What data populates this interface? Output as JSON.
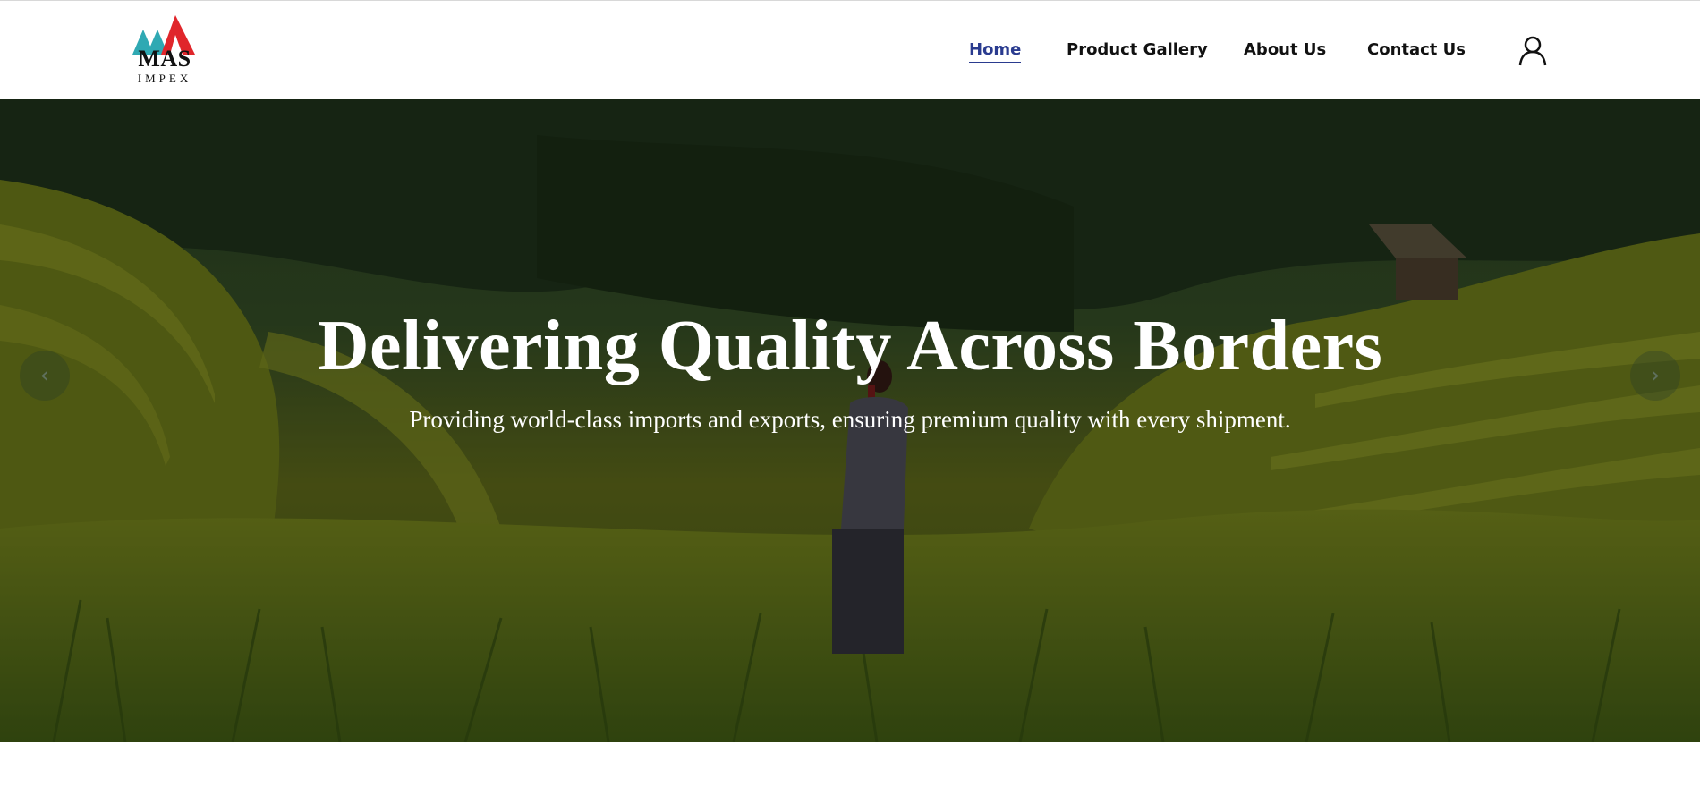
{
  "brand": {
    "name": "MAS",
    "sub": "IMPEX",
    "colors": {
      "teal": "#2fa9b3",
      "red": "#e0262b"
    }
  },
  "nav": {
    "items": [
      {
        "label": "Home",
        "active": true
      },
      {
        "label": "Product Gallery",
        "active": false
      },
      {
        "label": "About Us",
        "active": false
      },
      {
        "label": "Contact Us",
        "active": false
      }
    ],
    "active_color": "#2a3b8f",
    "account_icon": "user-icon"
  },
  "hero": {
    "title": "Delivering Quality Across Borders",
    "subtitle": "Providing world-class imports and exports, ensuring premium quality with every shipment.",
    "prev_glyph": "‹",
    "next_glyph": "›",
    "image": "rice-terrace-photo"
  }
}
